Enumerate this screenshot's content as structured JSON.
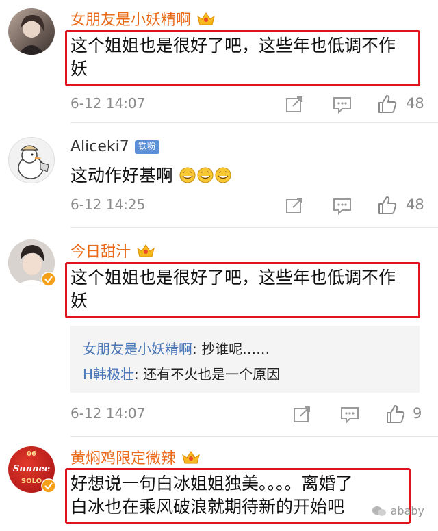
{
  "comments": [
    {
      "name": "女朋友是小妖精啊",
      "text_line1": "这个姐姐也是很好了吧，这些年也低调不作",
      "text_line2": "妖",
      "time": "6-12 14:07",
      "likes": "48"
    },
    {
      "name": "Aliceki7",
      "tag": "铁粉",
      "text": "这动作好基啊",
      "time": "6-12 14:25",
      "likes": "48"
    },
    {
      "name": "今日甜汁",
      "text_line1": "这个姐姐也是很好了吧，这些年也低调不作",
      "text_line2": "妖",
      "replies": [
        {
          "name": "女朋友是小妖精啊",
          "sep": ": ",
          "text": "抄谁呢……"
        },
        {
          "name": "H韩极壮",
          "sep": ": ",
          "text": "还有不火也是一个原因"
        }
      ],
      "time": "6-12 14:07",
      "likes": "9"
    },
    {
      "name": "黄焖鸡限定微辣",
      "text_line1": "好想说一句白冰姐姐独美。。。。离婚了",
      "text_line2": "白冰也在乘风破浪就期待新的开始吧",
      "avatar_text_top": "06",
      "avatar_text_mid": "Sunnee",
      "avatar_text_bot": "SOLO"
    }
  ],
  "watermark": "ababy",
  "colors": {
    "highlight": "#e0131f",
    "vip_name": "#e96b1a",
    "reply_name": "#4a77b8"
  }
}
